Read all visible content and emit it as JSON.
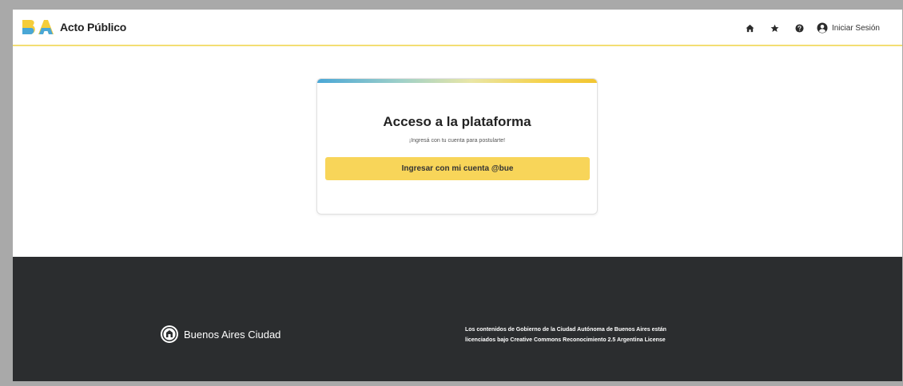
{
  "header": {
    "brand_logo_text": "BA",
    "brand_title": "Acto Público",
    "nav": [
      {
        "icon": "home-icon",
        "label": "Home"
      },
      {
        "icon": "star-icon",
        "label": "Favoritos"
      },
      {
        "icon": "help-icon",
        "label": "Ayuda"
      }
    ],
    "login_label": "Iniciar Sesión"
  },
  "card": {
    "title": "Acceso a la plataforma",
    "subtitle": "¡Ingresá con tu cuenta para postularte!",
    "button_label": "Ingresar con mi cuenta @bue"
  },
  "footer": {
    "brand_name": "Buenos Aires Ciudad",
    "license_line1": "Los contenidos de Gobierno de la Ciudad Autónoma de Buenos Aires están",
    "license_line2": "licenciados bajo Creative Commons Reconocimiento 2.5 Argentina License"
  },
  "colors": {
    "accent_yellow": "#f8d559",
    "header_border": "#f3de73",
    "footer_bg": "#2b2d2f",
    "logo_blue": "#4aa7d6"
  }
}
